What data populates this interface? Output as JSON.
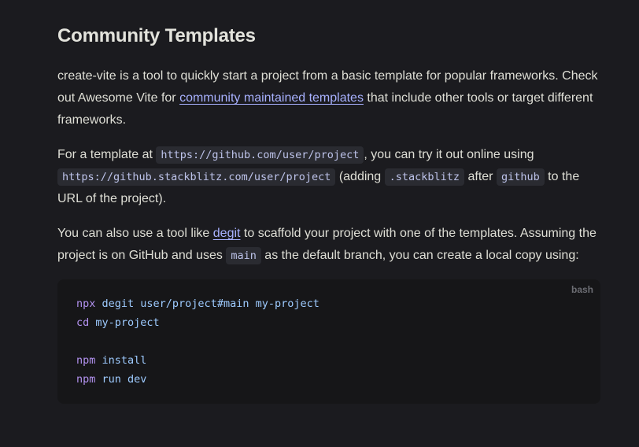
{
  "heading": "Community Templates",
  "p1": {
    "before": "create-vite is a tool to quickly start a project from a basic template for popular frameworks. Check out Awesome Vite for ",
    "link": "community maintained templates",
    "after": " that include other tools or target different frameworks."
  },
  "p2": {
    "t1": "For a template at ",
    "c1": "https://github.com/user/project",
    "t2": ", you can try it out online using ",
    "c2": "https://github.stackblitz.com/user/project",
    "t3": " (adding ",
    "c3": ".stackblitz",
    "t4": " after ",
    "c4": "github",
    "t5": " to the URL of the project)."
  },
  "p3": {
    "t1": "You can also use a tool like ",
    "link": "degit",
    "t2": " to scaffold your project with one of the templates. Assuming the project is on GitHub and uses ",
    "c1": "main",
    "t3": " as the default branch, you can create a local copy using:"
  },
  "code": {
    "lang": "bash",
    "lines": [
      {
        "cmd": "npx",
        "args": " degit user/project#main my-project"
      },
      {
        "cmd": "cd",
        "args": " my-project"
      },
      {
        "cmd": "",
        "args": ""
      },
      {
        "cmd": "npm",
        "args": " install"
      },
      {
        "cmd": "npm",
        "args": " run dev"
      }
    ]
  }
}
